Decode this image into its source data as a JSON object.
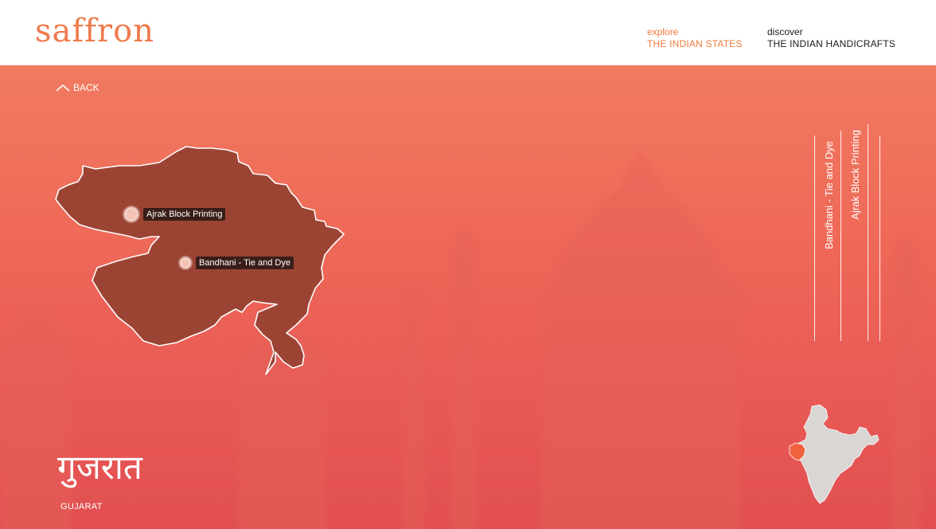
{
  "brand": {
    "logo": "saffron"
  },
  "nav": {
    "states": {
      "small": "explore",
      "big": "THE INDIAN STATES"
    },
    "crafts": {
      "small": "discover",
      "big": "THE INDIAN HANDICRAFTS"
    }
  },
  "back": {
    "label": "BACK"
  },
  "state": {
    "native_name": "गुजरात",
    "name": "GUJARAT"
  },
  "pins": [
    {
      "label": "Ajrak Block Printing"
    },
    {
      "label": "Bandhani - Tie and Dye"
    }
  ],
  "vertical_links": [
    {
      "label": "Bandhani - Tie and Dye"
    },
    {
      "label": "Ajrak Block Printing"
    }
  ],
  "colors": {
    "accent": "#ef7a3a",
    "state_fill": "#9c4434",
    "highlight_state": "#f0613e",
    "india_fill": "#d9d6d4"
  }
}
